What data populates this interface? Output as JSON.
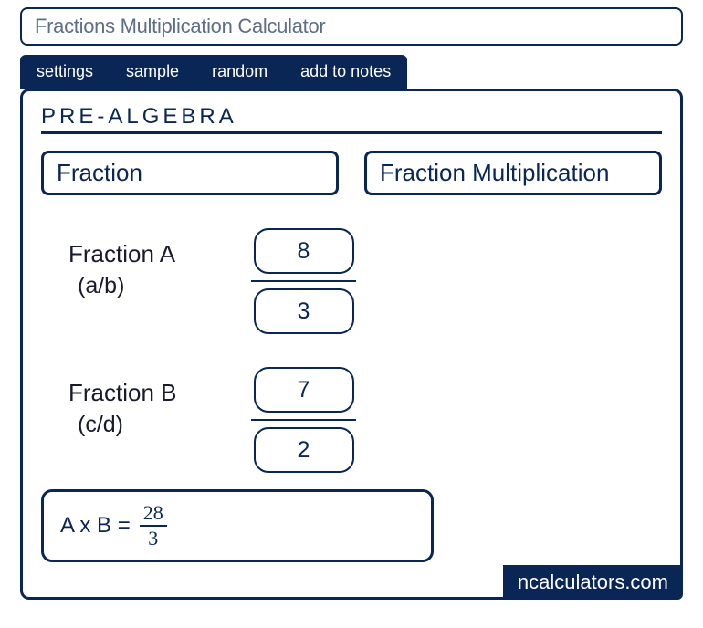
{
  "title": "Fractions Multiplication Calculator",
  "tabs": {
    "settings": "settings",
    "sample": "sample",
    "random": "random",
    "add_to_notes": "add to notes"
  },
  "section": "PRE-ALGEBRA",
  "selects": {
    "left": "Fraction",
    "right": "Fraction Multiplication"
  },
  "fields": {
    "a": {
      "label": "Fraction A",
      "sub": "(a/b)",
      "numerator": "8",
      "denominator": "3"
    },
    "b": {
      "label": "Fraction B",
      "sub": "(c/d)",
      "numerator": "7",
      "denominator": "2"
    }
  },
  "result": {
    "prefix": "A x B  =",
    "numerator": "28",
    "denominator": "3"
  },
  "brand": "ncalculators.com"
}
